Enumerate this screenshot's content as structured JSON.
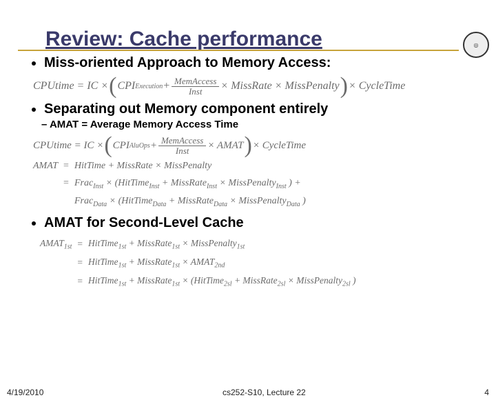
{
  "header": {
    "title": "Review: Cache performance",
    "logo_name": "university-seal"
  },
  "bullets": {
    "b1": "Miss-oriented Approach to Memory Access:",
    "b2": "Separating out Memory component entirely",
    "b2_sub": "AMAT = Average Memory Access Time",
    "b3": "AMAT for Second-Level Cache"
  },
  "formulas": {
    "f1_lhs": "CPUtime = IC ×",
    "f1_inner1": "CPI",
    "f1_inner1_sub": "Execution",
    "f1_plus": " + ",
    "f1_frac_num": "MemAccess",
    "f1_frac_den": "Inst",
    "f1_tail": " × MissRate × MissPenalty",
    "f1_end": " × CycleTime",
    "f2_lhs": "CPUtime = IC ×",
    "f2_inner1": "CPI",
    "f2_inner1_sub": "AluOps",
    "f2_frac_num": "MemAccess",
    "f2_frac_den": "Inst",
    "f2_tail": " × AMAT",
    "f2_end": " × CycleTime",
    "amat_lhs": "AMAT",
    "amat_rhs": "HitTime + MissRate × MissPenalty",
    "split_rhs1_a": "Frac",
    "split_rhs1_a_sub": "Inst",
    "split_rhs1_b": " × (HitTime",
    "split_rhs1_b_sub": "Inst",
    "split_rhs1_c": " + MissRate",
    "split_rhs1_c_sub": "Inst",
    "split_rhs1_d": " × MissPenalty",
    "split_rhs1_d_sub": "Inst",
    "split_rhs1_e": ") +",
    "split_rhs2_a": "Frac",
    "split_rhs2_a_sub": "Data",
    "split_rhs2_b": " × (HitTime",
    "split_rhs2_b_sub": "Data",
    "split_rhs2_c": " + MissRate",
    "split_rhs2_c_sub": "Data",
    "split_rhs2_d": " × MissPenalty",
    "split_rhs2_d_sub": "Data",
    "split_rhs2_e": ")",
    "l2_lhs": "AMAT",
    "l2_lhs_sub": "1st",
    "l2_r1_a": "HitTime",
    "l2_r1_a_sub": "1st",
    "l2_r1_b": " + MissRate",
    "l2_r1_b_sub": "1st",
    "l2_r1_c": " × MissPenalty",
    "l2_r1_c_sub": "1st",
    "l2_r2_a": "HitTime",
    "l2_r2_a_sub": "1st",
    "l2_r2_b": " + MissRate",
    "l2_r2_b_sub": "1st",
    "l2_r2_c": " × AMAT",
    "l2_r2_c_sub": "2nd",
    "l2_r3_a": "HitTime",
    "l2_r3_a_sub": "1st",
    "l2_r3_b": " + MissRate",
    "l2_r3_b_sub": "1st",
    "l2_r3_c": " × (HitTime",
    "l2_r3_c_sub": "2sl",
    "l2_r3_d": " + MissRate",
    "l2_r3_d_sub": "2sl",
    "l2_r3_e": " × MissPenalty",
    "l2_r3_e_sub": "2sl",
    "l2_r3_f": ")"
  },
  "footer": {
    "date": "4/19/2010",
    "mid": "cs252-S10, Lecture 22",
    "page": "4"
  }
}
